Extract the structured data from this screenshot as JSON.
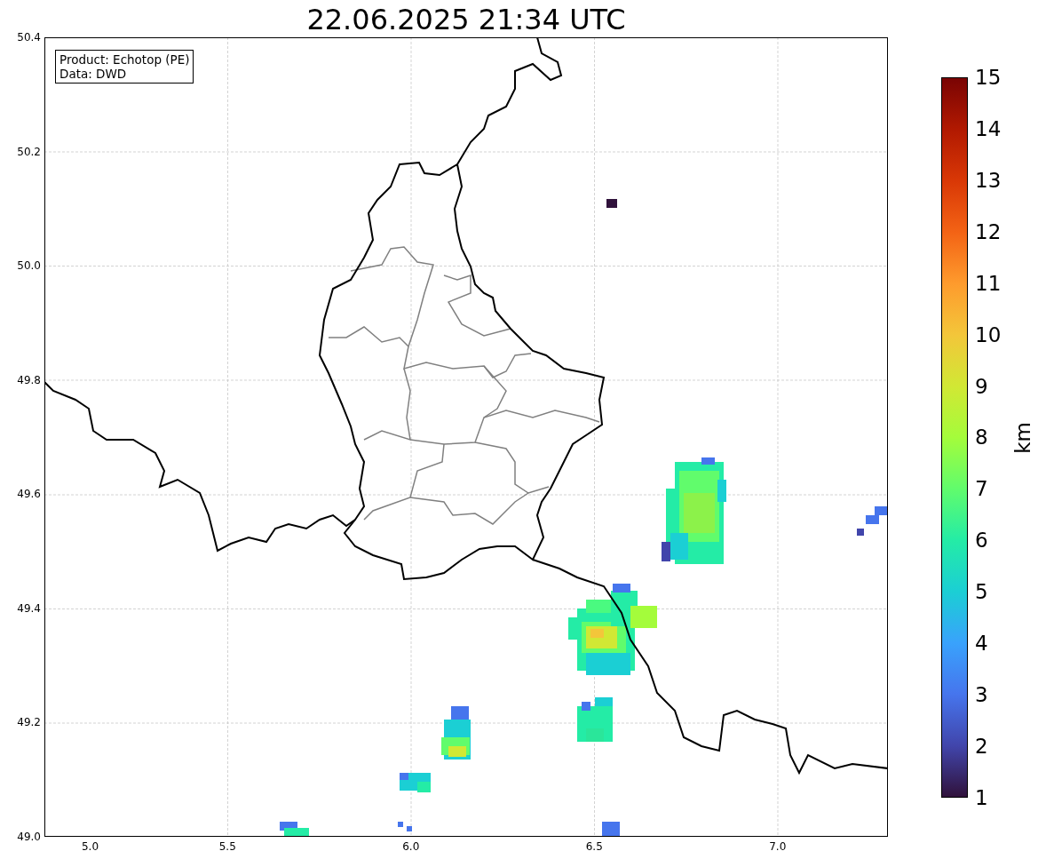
{
  "title": "22.06.2025 21:34 UTC",
  "legend": [
    "Product: Echotop (PE)",
    "Data: DWD"
  ],
  "x_ticks": [
    "5.0",
    "5.5",
    "6.0",
    "6.5",
    "7.0"
  ],
  "y_ticks": [
    "50.4",
    "50.2",
    "50.0",
    "49.8",
    "49.6",
    "49.4",
    "49.2",
    "49.0"
  ],
  "colorbar": {
    "label": "km",
    "ticks": [
      "15",
      "14",
      "13",
      "12",
      "11",
      "10",
      "9",
      "8",
      "7",
      "6",
      "5",
      "4",
      "3",
      "2",
      "1"
    ]
  }
}
